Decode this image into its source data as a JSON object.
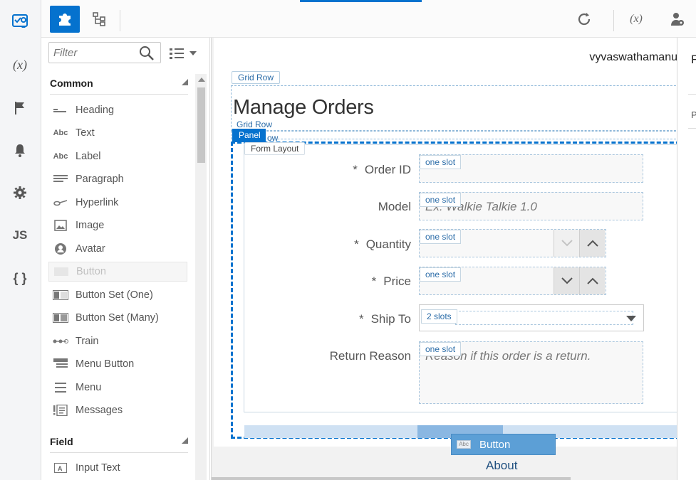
{
  "rail": {
    "items": [
      {
        "name": "components-icon",
        "glyph": ""
      },
      {
        "name": "variables-icon",
        "glyph": "(x)"
      },
      {
        "name": "flag-icon",
        "glyph": ""
      },
      {
        "name": "bell-icon",
        "glyph": ""
      },
      {
        "name": "gear-icon",
        "glyph": ""
      },
      {
        "name": "js-icon",
        "glyph": "JS"
      },
      {
        "name": "json-icon",
        "glyph": "{ }"
      }
    ]
  },
  "palette": {
    "filter_placeholder": "Filter",
    "sections": [
      {
        "title": "Common",
        "items": [
          {
            "label": "Heading",
            "icon": "heading-icon"
          },
          {
            "label": "Text",
            "icon": "text-icon"
          },
          {
            "label": "Label",
            "icon": "label-icon"
          },
          {
            "label": "Paragraph",
            "icon": "paragraph-icon"
          },
          {
            "label": "Hyperlink",
            "icon": "hyperlink-icon"
          },
          {
            "label": "Image",
            "icon": "image-icon"
          },
          {
            "label": "Avatar",
            "icon": "avatar-icon"
          },
          {
            "label": "Button",
            "icon": "button-icon",
            "disabled": true
          },
          {
            "label": "Button Set (One)",
            "icon": "button-set-one-icon"
          },
          {
            "label": "Button Set (Many)",
            "icon": "button-set-many-icon"
          },
          {
            "label": "Train",
            "icon": "train-icon"
          },
          {
            "label": "Menu Button",
            "icon": "menu-button-icon"
          },
          {
            "label": "Menu",
            "icon": "menu-icon"
          },
          {
            "label": "Messages",
            "icon": "messages-icon"
          }
        ]
      },
      {
        "title": "Field",
        "items": [
          {
            "label": "Input Text",
            "icon": "input-text-icon"
          }
        ]
      }
    ]
  },
  "canvas": {
    "username": "vyvaswathamanu",
    "grid_row_label": "Grid Row",
    "grid_row_label_2": "Grid Row",
    "grid_row_label_3": "ow",
    "page_title": "Manage Orders",
    "panel_label": "Panel",
    "form_layout_label": "Form Layout",
    "fields": [
      {
        "label": "Order ID",
        "required": true,
        "slot": "one slot",
        "placeholder": ""
      },
      {
        "label": "Model",
        "required": false,
        "slot": "one slot",
        "placeholder": "Ex: Walkie Talkie 1.0"
      },
      {
        "label": "Quantity",
        "required": true,
        "slot": "one slot",
        "placeholder": ""
      },
      {
        "label": "Price",
        "required": true,
        "slot": "one slot",
        "placeholder": ""
      },
      {
        "label": "Ship To",
        "required": true,
        "slot": "2 slots",
        "placeholder": ""
      },
      {
        "label": "Return Reason",
        "required": false,
        "slot": "one slot",
        "placeholder": "Reason if this order is a return."
      }
    ],
    "required_mark": "*",
    "drag_button_label": "Button",
    "drag_button_chip": "Abc",
    "about_text": "About"
  },
  "props": {
    "title_partial": "F",
    "label_partial": "P"
  },
  "colors": {
    "accent": "#0572ce",
    "slot_text": "#2b6ca8"
  }
}
